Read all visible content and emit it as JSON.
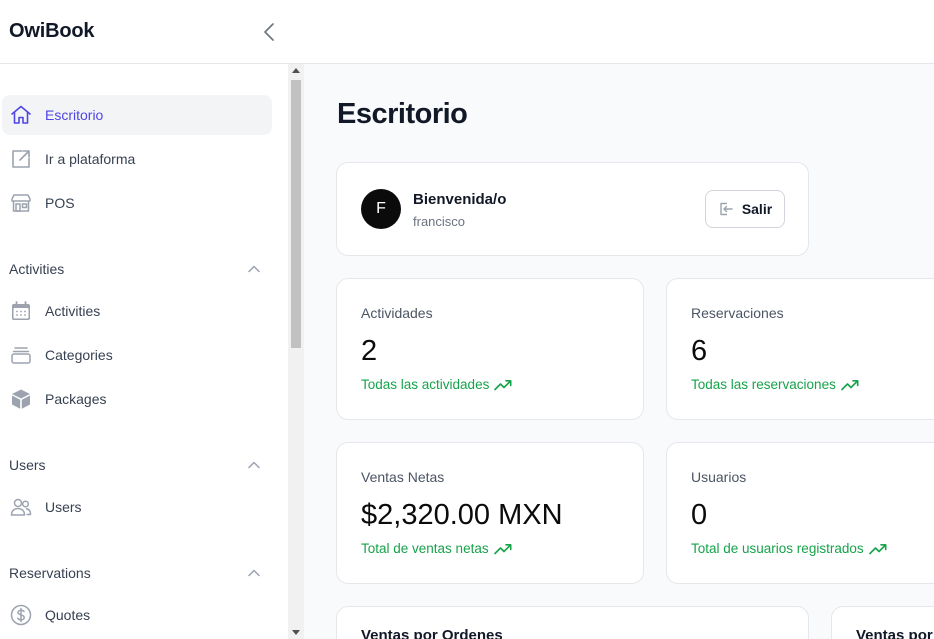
{
  "app": {
    "brand": "OwiBook"
  },
  "sidebar": {
    "top_items": [
      {
        "label": "Escritorio",
        "icon": "home-icon",
        "active": true
      },
      {
        "label": "Ir a plataforma",
        "icon": "external-link-icon"
      },
      {
        "label": "POS",
        "icon": "store-icon"
      }
    ],
    "sections": [
      {
        "title": "Activities",
        "items": [
          {
            "label": "Activities",
            "icon": "calendar-icon"
          },
          {
            "label": "Categories",
            "icon": "stack-icon"
          },
          {
            "label": "Packages",
            "icon": "cube-icon"
          }
        ]
      },
      {
        "title": "Users",
        "items": [
          {
            "label": "Users",
            "icon": "users-icon"
          }
        ]
      },
      {
        "title": "Reservations",
        "items": [
          {
            "label": "Quotes",
            "icon": "dollar-circle-icon"
          }
        ]
      }
    ]
  },
  "main": {
    "title": "Escritorio",
    "welcome": {
      "avatar_initial": "F",
      "greeting": "Bienvenida/o",
      "username": "francisco",
      "logout_label": "Salir"
    },
    "stats": [
      {
        "label": "Actividades",
        "value": "2",
        "link": "Todas las actividades"
      },
      {
        "label": "Reservaciones",
        "value": "6",
        "link": "Todas las reservaciones"
      },
      {
        "label": "Ventas Netas",
        "value": "$2,320.00 MXN",
        "link": "Total de ventas netas"
      },
      {
        "label": "Usuarios",
        "value": "0",
        "link": "Total de usuarios registrados"
      }
    ],
    "charts": [
      {
        "title": "Ventas por Ordenes"
      },
      {
        "title": "Ventas por"
      }
    ]
  },
  "colors": {
    "accent": "#4f46e5",
    "positive": "#16a34a",
    "border": "#e5e7eb",
    "background": "#f9fafb"
  }
}
